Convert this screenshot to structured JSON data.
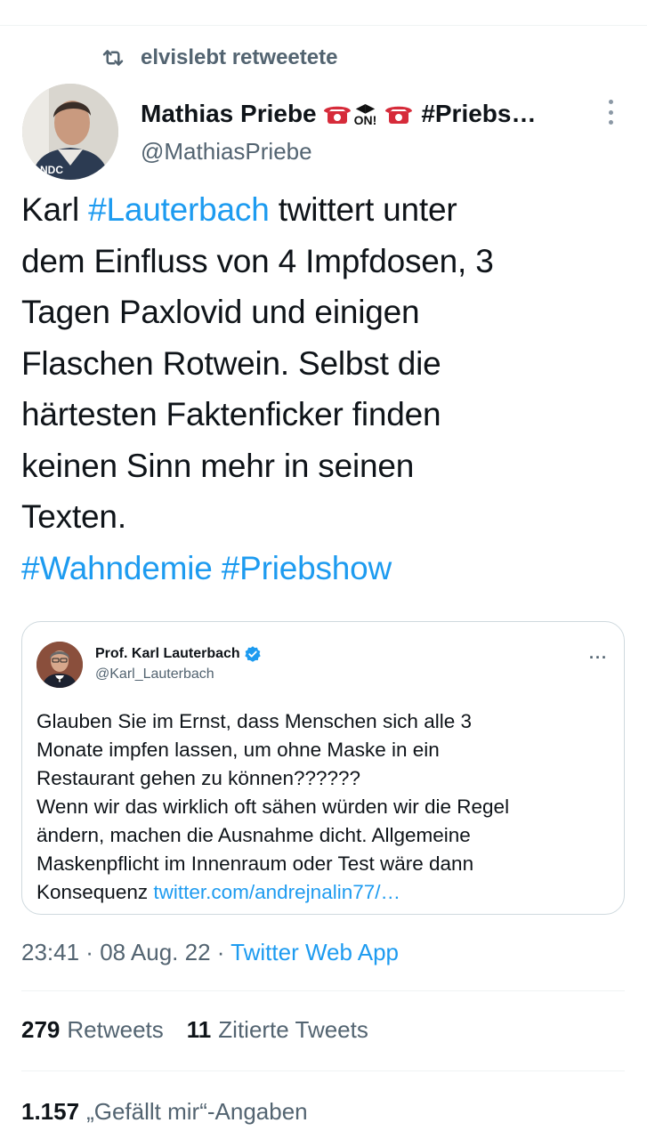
{
  "retweet": {
    "text": "elvislebt retweetete",
    "icon": "retweet-icon"
  },
  "author": {
    "name": "Mathias Priebe",
    "phone_emoji": "☎",
    "on_label": "ON!",
    "name_suffix": "#Priebs…",
    "handle": "@MathiasPriebe"
  },
  "tweet": {
    "w1": "Karl ",
    "h1": "#Lauterbach",
    "w2": " twittert unter",
    "l2": "dem Einfluss von 4 Impfdosen, 3",
    "l3": "Tagen Paxlovid und einigen",
    "l4": "Flaschen Rotwein. Selbst die",
    "l5": "härtesten Faktenficker finden",
    "l6": "keinen Sinn mehr in seinen",
    "l7": "Texten.",
    "h2": "#Wahndemie",
    "h3": "#Priebshow"
  },
  "quote": {
    "name": "Prof. Karl Lauterbach",
    "handle": "@Karl_Lauterbach",
    "more": "···",
    "l1": "Glauben Sie im Ernst, dass Menschen sich alle 3",
    "l2": "Monate impfen lassen, um ohne Maske in ein",
    "l3": "Restaurant gehen zu können??????",
    "l4": "Wenn wir das wirklich oft sähen würden wir die Regel",
    "l5": "ändern, machen die Ausnahme dicht. Allgemeine",
    "l6": "Maskenpflicht im Innenraum oder Test wäre dann",
    "l7_text": "Konsequenz ",
    "l7_link": "twitter.com/andrejnalin77/…"
  },
  "meta": {
    "time": "23:41",
    "date": "08 Aug. 22",
    "sep": " · ",
    "app": "Twitter Web App"
  },
  "stats": {
    "retweets_count": "279",
    "retweets_label": "Retweets",
    "quotes_count": "11",
    "quotes_label": "Zitierte Tweets",
    "likes_count": "1.157",
    "likes_label": "„Gefällt mir“-Angaben"
  },
  "colors": {
    "link": "#1d9bf0",
    "secondary": "#536471",
    "border": "#cfd9de"
  }
}
